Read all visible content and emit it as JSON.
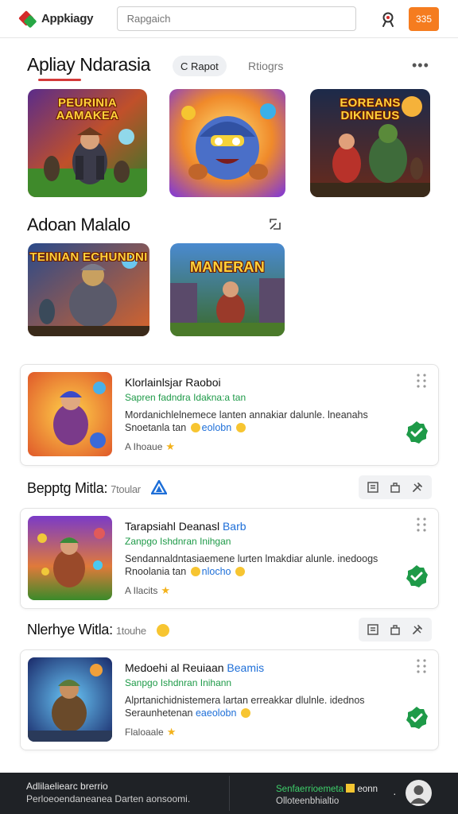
{
  "header": {
    "logo_text": "Appkiagy",
    "search_placeholder": "Rapgaich",
    "action_label": "335"
  },
  "featured": {
    "title": "Apliay Ndarasia",
    "chip_label": "C Rapot",
    "link_label": "Rtiogrs",
    "more_label": "•••",
    "tiles": [
      {
        "label": "PEURINIA AAMAKEA"
      },
      {
        "label": ""
      },
      {
        "label": "EOREANS DIKINEUS"
      }
    ]
  },
  "section2": {
    "title": "Adoan Malalo",
    "tiles": [
      {
        "label": "TEINIAN ECHUNDNI"
      },
      {
        "label": "MANERAN"
      }
    ]
  },
  "apps": [
    {
      "title": "Klorlainlsjar Raoboi",
      "title_hl": "",
      "subtitle": "Sapren fadndra Idakna:a tan",
      "desc_line1": "Mordanichlelnemece lanten annakiar dalunle. lneanahs",
      "desc_line2_a": "Snoetanla tan",
      "desc_line2_hl": "eolobn",
      "meta": "A Ihoaue"
    },
    {
      "title": "Tarapsiahl Deanasl",
      "title_hl": "Barb",
      "subtitle": "Zanpgo Ishdnran Inihgan",
      "desc_line1": "Sendannaldntasiaemene lurten lmakdiar alunle. inedoogs",
      "desc_line2_a": "Rnoolania tan",
      "desc_line2_hl": "nlocho",
      "meta": "A Ilacits"
    },
    {
      "title": "Medoehi al Reuiaan",
      "title_hl": "Beamis",
      "subtitle": "Sanpgo Ishdnran Inihann",
      "desc_line1": "Alprtanichidnistemera lartan erreakkar dlulnle. idednos",
      "desc_line2_a": "Seraunhetenan",
      "desc_line2_hl": "eaeolobn",
      "meta": "Flaloaale"
    }
  ],
  "rows": [
    {
      "title": "Bepptg Mitla:",
      "sub": "7toular"
    },
    {
      "title": "Nlerhye Witla:",
      "sub": "1touhe"
    }
  ],
  "footer": {
    "left_line1": "Adlilaeliearc brerrio",
    "left_line2": "Perloeoendaneanea Darten aonsoomi.",
    "right_line1_a": "Senfaerrioemeta",
    "right_line1_b": "eonn",
    "right_line2": "Olloteenbhialtio",
    "dot": "·"
  },
  "colors": {
    "accent_orange": "#f57c1f",
    "brand_red": "#d42a2a",
    "brand_green": "#27a745",
    "link_blue": "#1e6fd8",
    "subtitle_green": "#1e9a48",
    "footer_bg": "#1f2226"
  },
  "icons": {
    "header_profile": "user-scan-icon",
    "card_menu": "drag-dots-icon",
    "card_status": "verified-check-icon",
    "toolbar": [
      "document-icon",
      "bag-icon",
      "tools-icon"
    ],
    "section2_expand": "expand-icon"
  }
}
